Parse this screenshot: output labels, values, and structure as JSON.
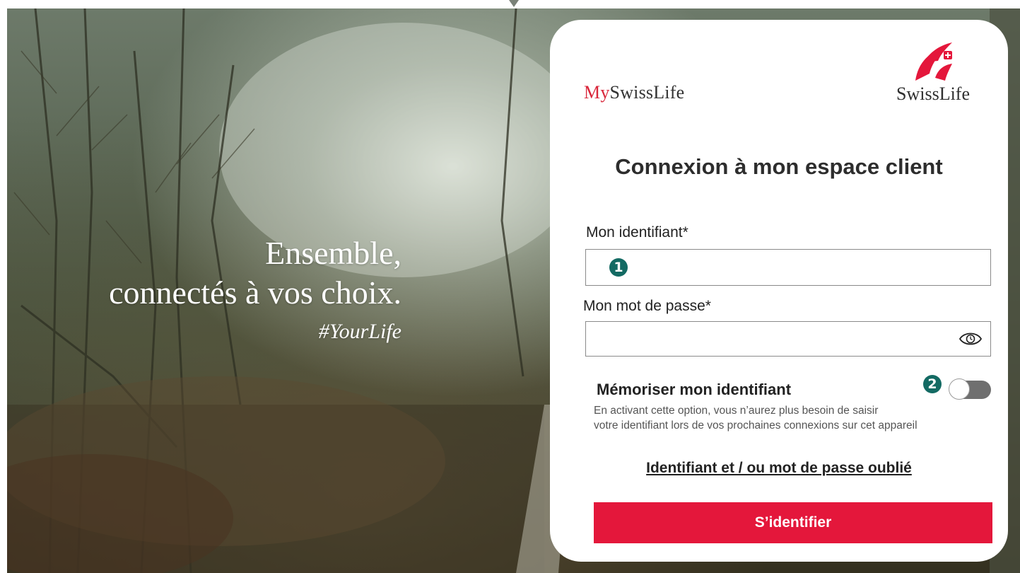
{
  "hero": {
    "line1": "Ensemble,",
    "line2": "connectés à vos choix.",
    "hashtag": "#YourLife"
  },
  "brand": {
    "my_prefix": "My",
    "my_name": "SwissLife",
    "logo_text": "SwissLife",
    "logo_color": "#e4173b"
  },
  "login": {
    "title": "Connexion à mon espace client",
    "identifier_label": "Mon identifiant*",
    "identifier_value": "",
    "password_label": "Mon mot de passe*",
    "password_value": "",
    "marker_1": "1",
    "marker_2": "2",
    "password_toggle_icon": "eye-icon",
    "remember_title": "Mémoriser mon identifiant",
    "remember_desc_line1": "En activant cette option, vous n’aurez plus besoin de saisir",
    "remember_desc_line2": "votre identifiant lors de vos prochaines connexions sur cet appareil",
    "remember_on": false,
    "forgot_link": "Identifiant et / ou mot de passe oublié",
    "submit_label": "S’identifier",
    "submit_color": "#e4173b",
    "marker_color": "#136a63"
  }
}
